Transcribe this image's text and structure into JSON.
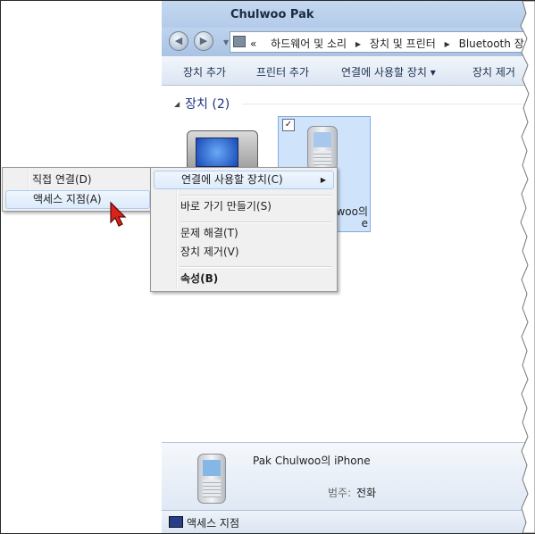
{
  "window": {
    "title": "Chulwoo Pak",
    "nav": {
      "back_icon": "back-arrow-icon",
      "forward_icon": "forward-arrow-icon"
    },
    "breadcrumb": {
      "overflow": "«",
      "items": [
        "하드웨어 및 소리",
        "장치 및 프린터",
        "Bluetooth 장"
      ]
    },
    "toolbar": {
      "add_device": "장치 추가",
      "add_printer": "프린터 추가",
      "connect_using": "연결에 사용할 장치 ▾",
      "remove_device": "장치 제거"
    },
    "group": {
      "label": "장치 (2)"
    },
    "devices": [
      {
        "name": "",
        "icon": "camera-device-icon"
      },
      {
        "name_line1": "woo의",
        "name_line2": "e",
        "checked": true,
        "icon": "phone-device-icon"
      }
    ],
    "details": {
      "device_name": "Pak Chulwoo의 iPhone",
      "category_label": "범주:",
      "category_value": "전화"
    },
    "status": {
      "text": "액세스 지점"
    }
  },
  "context_menu": {
    "items": [
      {
        "label": "연결에 사용할 장치(C)",
        "has_submenu": true,
        "highlighted": true
      },
      {
        "label": "바로 가기 만들기(S)"
      },
      {
        "label": "문제 해결(T)"
      },
      {
        "label": "장치 제거(V)"
      },
      {
        "label": "속성(B)",
        "bold": true
      }
    ]
  },
  "submenu": {
    "items": [
      {
        "label": "직접 연결(D)"
      },
      {
        "label": "액세스 지점(A)",
        "highlighted": true
      }
    ]
  },
  "colors": {
    "accent": "#1e3287",
    "highlight": "#dcebfc",
    "titlebar": "#b3cbea"
  }
}
